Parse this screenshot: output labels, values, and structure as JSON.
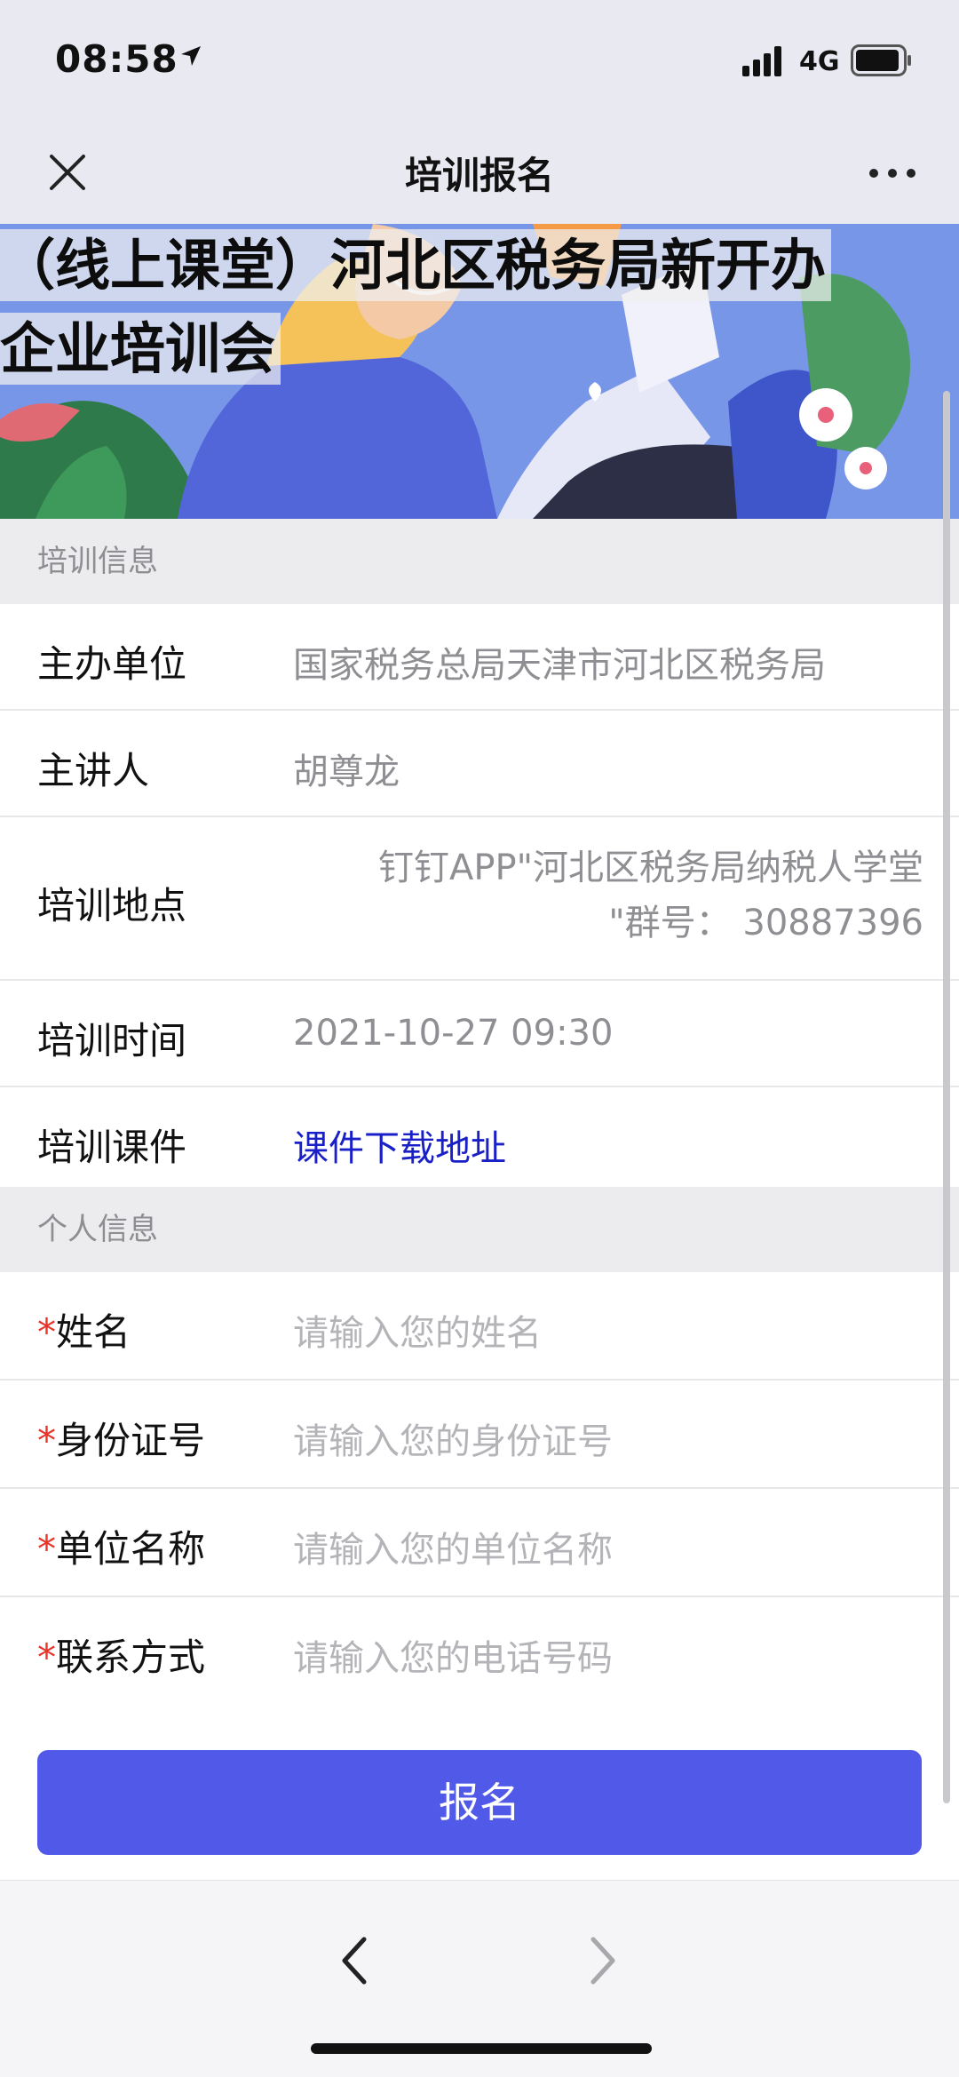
{
  "status": {
    "time": "08:58",
    "network": "4G"
  },
  "nav": {
    "title": "培训报名",
    "close_icon": "close-icon",
    "more_icon": "more-icon"
  },
  "banner": {
    "title_line1": "（线上课堂）河北区税务局新开办",
    "title_line2": "企业培训会"
  },
  "training_info": {
    "header": "培训信息",
    "rows": [
      {
        "label": "主办单位",
        "value": "国家税务总局天津市河北区税务局"
      },
      {
        "label": "主讲人",
        "value": "胡尊龙"
      },
      {
        "label": "培训地点",
        "value_line1": "钉钉APP\"河北区税务局纳税人学堂",
        "value_line2": "\"群号： 30887396"
      },
      {
        "label": "培训时间",
        "value": "2021-10-27 09:30"
      },
      {
        "label": "培训课件",
        "value": "课件下载地址"
      }
    ]
  },
  "personal_info": {
    "header": "个人信息",
    "required_mark": "*",
    "fields": [
      {
        "label": "姓名",
        "placeholder": "请输入您的姓名"
      },
      {
        "label": "身份证号",
        "placeholder": "请输入您的身份证号"
      },
      {
        "label": "单位名称",
        "placeholder": "请输入您的单位名称"
      },
      {
        "label": "联系方式",
        "placeholder": "请输入您的电话号码"
      }
    ]
  },
  "submit": {
    "label": "报名"
  },
  "colors": {
    "accent": "#5059e8",
    "link": "#1a20c8",
    "required": "#e5342a",
    "banner_bg": "#6f8fe6"
  }
}
